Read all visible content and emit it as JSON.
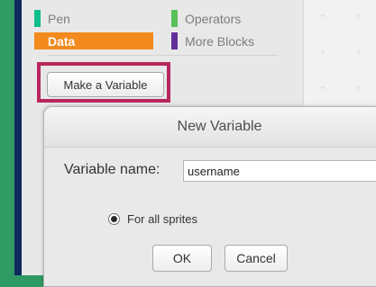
{
  "palette": {
    "categories": [
      {
        "label": "Pen",
        "color": "#0fbd8c",
        "selected": false
      },
      {
        "label": "Operators",
        "color": "#59c059",
        "selected": false
      },
      {
        "label": "Data",
        "color": "#f28a1e",
        "selected": true
      },
      {
        "label": "More Blocks",
        "color": "#632d99",
        "selected": false
      }
    ],
    "make_variable_label": "Make a Variable",
    "highlight_color": "#b8275e"
  },
  "dialog": {
    "title": "New Variable",
    "variable_name_label": "Variable name:",
    "variable_name_value": "username",
    "scope_option_label": "For all sprites",
    "ok_label": "OK",
    "cancel_label": "Cancel"
  },
  "colors": {
    "outer_frame": "#2f9a63",
    "inner_border": "#0f2a5c",
    "data_category": "#f28a1e"
  }
}
